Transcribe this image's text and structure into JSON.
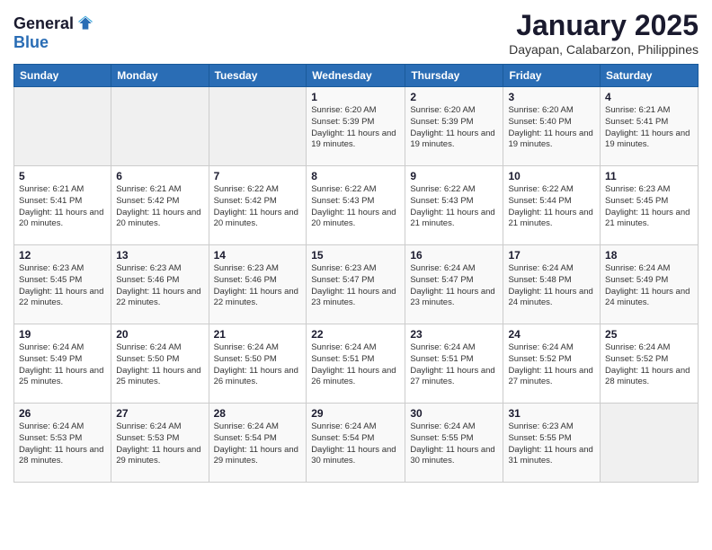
{
  "header": {
    "logo_general": "General",
    "logo_blue": "Blue",
    "month_title": "January 2025",
    "location": "Dayapan, Calabarzon, Philippines"
  },
  "days_of_week": [
    "Sunday",
    "Monday",
    "Tuesday",
    "Wednesday",
    "Thursday",
    "Friday",
    "Saturday"
  ],
  "weeks": [
    [
      {
        "date": "",
        "info": ""
      },
      {
        "date": "",
        "info": ""
      },
      {
        "date": "",
        "info": ""
      },
      {
        "date": "1",
        "sunrise": "6:20 AM",
        "sunset": "5:39 PM",
        "daylight": "11 hours and 19 minutes."
      },
      {
        "date": "2",
        "sunrise": "6:20 AM",
        "sunset": "5:39 PM",
        "daylight": "11 hours and 19 minutes."
      },
      {
        "date": "3",
        "sunrise": "6:20 AM",
        "sunset": "5:40 PM",
        "daylight": "11 hours and 19 minutes."
      },
      {
        "date": "4",
        "sunrise": "6:21 AM",
        "sunset": "5:41 PM",
        "daylight": "11 hours and 19 minutes."
      }
    ],
    [
      {
        "date": "5",
        "sunrise": "6:21 AM",
        "sunset": "5:41 PM",
        "daylight": "11 hours and 20 minutes."
      },
      {
        "date": "6",
        "sunrise": "6:21 AM",
        "sunset": "5:42 PM",
        "daylight": "11 hours and 20 minutes."
      },
      {
        "date": "7",
        "sunrise": "6:22 AM",
        "sunset": "5:42 PM",
        "daylight": "11 hours and 20 minutes."
      },
      {
        "date": "8",
        "sunrise": "6:22 AM",
        "sunset": "5:43 PM",
        "daylight": "11 hours and 20 minutes."
      },
      {
        "date": "9",
        "sunrise": "6:22 AM",
        "sunset": "5:43 PM",
        "daylight": "11 hours and 21 minutes."
      },
      {
        "date": "10",
        "sunrise": "6:22 AM",
        "sunset": "5:44 PM",
        "daylight": "11 hours and 21 minutes."
      },
      {
        "date": "11",
        "sunrise": "6:23 AM",
        "sunset": "5:45 PM",
        "daylight": "11 hours and 21 minutes."
      }
    ],
    [
      {
        "date": "12",
        "sunrise": "6:23 AM",
        "sunset": "5:45 PM",
        "daylight": "11 hours and 22 minutes."
      },
      {
        "date": "13",
        "sunrise": "6:23 AM",
        "sunset": "5:46 PM",
        "daylight": "11 hours and 22 minutes."
      },
      {
        "date": "14",
        "sunrise": "6:23 AM",
        "sunset": "5:46 PM",
        "daylight": "11 hours and 22 minutes."
      },
      {
        "date": "15",
        "sunrise": "6:23 AM",
        "sunset": "5:47 PM",
        "daylight": "11 hours and 23 minutes."
      },
      {
        "date": "16",
        "sunrise": "6:24 AM",
        "sunset": "5:47 PM",
        "daylight": "11 hours and 23 minutes."
      },
      {
        "date": "17",
        "sunrise": "6:24 AM",
        "sunset": "5:48 PM",
        "daylight": "11 hours and 24 minutes."
      },
      {
        "date": "18",
        "sunrise": "6:24 AM",
        "sunset": "5:49 PM",
        "daylight": "11 hours and 24 minutes."
      }
    ],
    [
      {
        "date": "19",
        "sunrise": "6:24 AM",
        "sunset": "5:49 PM",
        "daylight": "11 hours and 25 minutes."
      },
      {
        "date": "20",
        "sunrise": "6:24 AM",
        "sunset": "5:50 PM",
        "daylight": "11 hours and 25 minutes."
      },
      {
        "date": "21",
        "sunrise": "6:24 AM",
        "sunset": "5:50 PM",
        "daylight": "11 hours and 26 minutes."
      },
      {
        "date": "22",
        "sunrise": "6:24 AM",
        "sunset": "5:51 PM",
        "daylight": "11 hours and 26 minutes."
      },
      {
        "date": "23",
        "sunrise": "6:24 AM",
        "sunset": "5:51 PM",
        "daylight": "11 hours and 27 minutes."
      },
      {
        "date": "24",
        "sunrise": "6:24 AM",
        "sunset": "5:52 PM",
        "daylight": "11 hours and 27 minutes."
      },
      {
        "date": "25",
        "sunrise": "6:24 AM",
        "sunset": "5:52 PM",
        "daylight": "11 hours and 28 minutes."
      }
    ],
    [
      {
        "date": "26",
        "sunrise": "6:24 AM",
        "sunset": "5:53 PM",
        "daylight": "11 hours and 28 minutes."
      },
      {
        "date": "27",
        "sunrise": "6:24 AM",
        "sunset": "5:53 PM",
        "daylight": "11 hours and 29 minutes."
      },
      {
        "date": "28",
        "sunrise": "6:24 AM",
        "sunset": "5:54 PM",
        "daylight": "11 hours and 29 minutes."
      },
      {
        "date": "29",
        "sunrise": "6:24 AM",
        "sunset": "5:54 PM",
        "daylight": "11 hours and 30 minutes."
      },
      {
        "date": "30",
        "sunrise": "6:24 AM",
        "sunset": "5:55 PM",
        "daylight": "11 hours and 30 minutes."
      },
      {
        "date": "31",
        "sunrise": "6:23 AM",
        "sunset": "5:55 PM",
        "daylight": "11 hours and 31 minutes."
      },
      {
        "date": "",
        "info": ""
      }
    ]
  ],
  "labels": {
    "sunrise": "Sunrise:",
    "sunset": "Sunset:",
    "daylight": "Daylight:"
  }
}
